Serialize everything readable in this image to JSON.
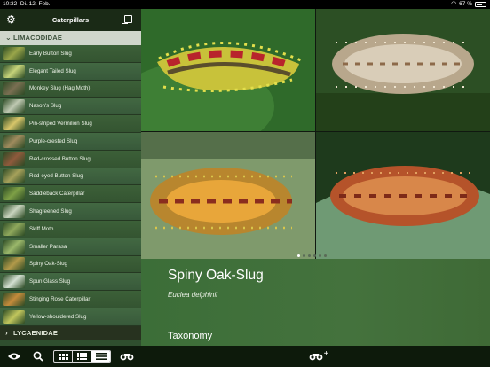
{
  "status": {
    "time": "10:32",
    "date": "Di. 12. Feb.",
    "battery_text": "67 %",
    "battery_level": 0.67
  },
  "sidebar": {
    "title": "Caterpillars",
    "groups": [
      {
        "label": "LIMACODIDAE",
        "items": [
          {
            "label": "Early Button Slug",
            "color": "#9aa64a"
          },
          {
            "label": "Elegant Tailed Slug",
            "color": "#c6d47a"
          },
          {
            "label": "Monkey Slug (Hag Moth)",
            "color": "#7a6f52"
          },
          {
            "label": "Nason's Slug",
            "color": "#bfc9b2"
          },
          {
            "label": "Pin-striped Vermilion Slug",
            "color": "#d8c66a"
          },
          {
            "label": "Purple-crested Slug",
            "color": "#9f8b5e"
          },
          {
            "label": "Red-crossed Button Slug",
            "color": "#8f5a3c"
          },
          {
            "label": "Red-eyed Button Slug",
            "color": "#a6a15b"
          },
          {
            "label": "Saddleback Caterpillar",
            "color": "#7ea046"
          },
          {
            "label": "Shagreened Slug",
            "color": "#c9d5bf"
          },
          {
            "label": "Skiff Moth",
            "color": "#8fa85c"
          },
          {
            "label": "Smaller Parasa",
            "color": "#9bb86b"
          },
          {
            "label": "Spiny Oak-Slug",
            "color": "#b39a4a"
          },
          {
            "label": "Spun Glass Slug",
            "color": "#d4e0d2"
          },
          {
            "label": "Stinging Rose Caterpillar",
            "color": "#c48b3b"
          },
          {
            "label": "Yellow-shouldered Slug",
            "color": "#c1c65d"
          }
        ]
      },
      {
        "label": "LYCAENIDAE",
        "items": []
      }
    ]
  },
  "detail": {
    "common_name": "Spiny Oak-Slug",
    "scientific_name": "Euclea delphinii",
    "section": "Taxonomy"
  },
  "gallery": {
    "page_count": 6,
    "active_page": 0
  },
  "toolbar": {
    "eye_icon": "eye-icon",
    "search_icon": "search-icon",
    "binoculars_plus": "+"
  }
}
